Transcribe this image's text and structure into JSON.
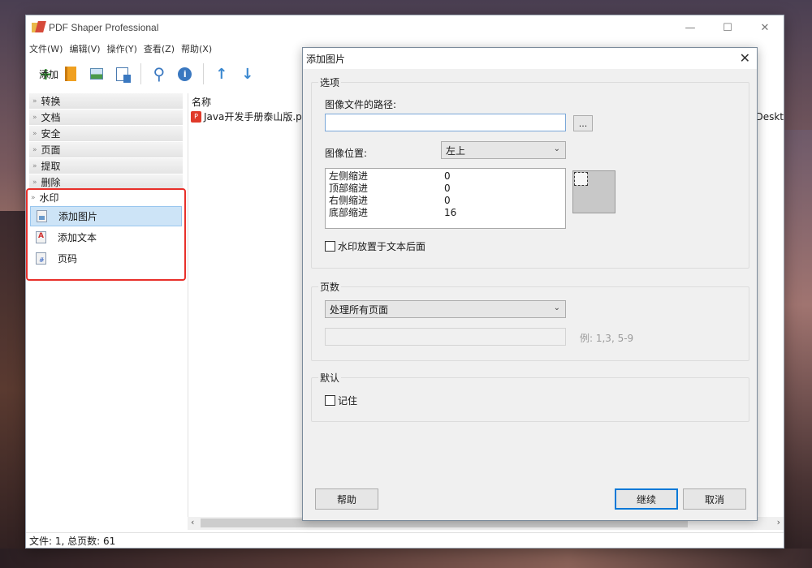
{
  "app": {
    "title": "PDF Shaper Professional",
    "window_controls": {
      "minimize": "—",
      "maximize": "☐",
      "close": "✕"
    }
  },
  "menubar": [
    "文件(W)",
    "编辑(V)",
    "操作(Y)",
    "查看(Z)",
    "帮助(X)"
  ],
  "toolbar": {
    "add_label": "添加",
    "add_symbol": "+"
  },
  "sidebar": {
    "categories": [
      "转换",
      "文档",
      "安全",
      "页面",
      "提取",
      "删除"
    ],
    "watermark": {
      "label": "水印",
      "items": [
        "添加图片",
        "添加文本",
        "页码"
      ]
    }
  },
  "filelist": {
    "header": "名称",
    "file_name": "Java开发手册泰山版.pc",
    "path_fragment": "Deskt"
  },
  "statusbar": "文件: 1, 总页数: 61",
  "dialog": {
    "title": "添加图片",
    "options": {
      "group_label": "选项",
      "path_label": "图像文件的路径:",
      "path_value": "",
      "browse_label": "...",
      "position_label": "图像位置:",
      "position_value": "左上",
      "indents": [
        {
          "label": "左侧缩进",
          "value": "0"
        },
        {
          "label": "顶部缩进",
          "value": "0"
        },
        {
          "label": "右侧缩进",
          "value": "0"
        },
        {
          "label": "底部缩进",
          "value": "16"
        }
      ],
      "behind_text_label": "水印放置于文本后面",
      "behind_text_checked": false
    },
    "pages": {
      "group_label": "页数",
      "range_value": "处理所有页面",
      "custom_value": "",
      "hint": "例: 1,3, 5-9"
    },
    "defaults": {
      "group_label": "默认",
      "remember_label": "记住",
      "remember_checked": false
    },
    "buttons": {
      "help": "帮助",
      "continue": "继续",
      "cancel": "取消"
    }
  },
  "colors": {
    "highlight_border": "#e8302a",
    "selected_bg": "#cde4f7",
    "accent": "#0078d7"
  }
}
